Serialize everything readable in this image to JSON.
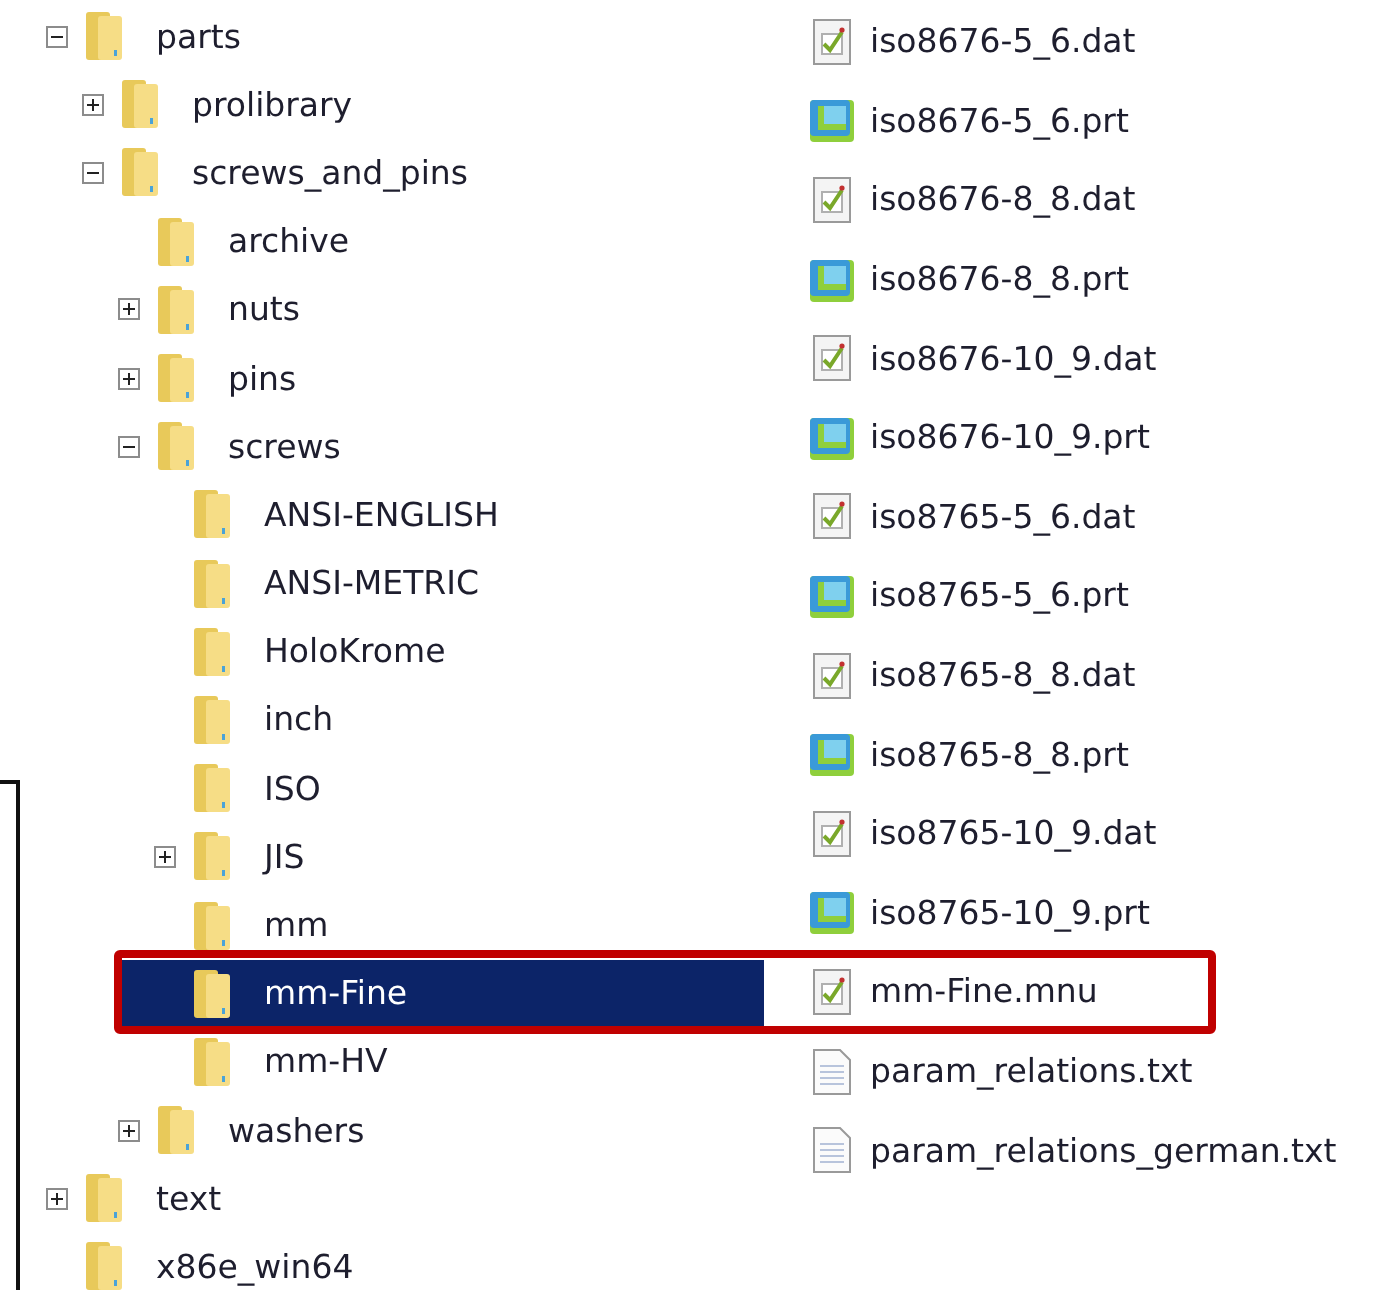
{
  "tree": [
    {
      "label": "parts",
      "expanded": true,
      "selected": false,
      "children": [
        {
          "label": "prolibrary",
          "expanded": false,
          "selected": false
        },
        {
          "label": "screws_and_pins",
          "expanded": true,
          "selected": false,
          "children": [
            {
              "label": "archive",
              "selected": false
            },
            {
              "label": "nuts",
              "expanded": false,
              "selected": false
            },
            {
              "label": "pins",
              "expanded": false,
              "selected": false
            },
            {
              "label": "screws",
              "expanded": true,
              "selected": false,
              "children": [
                {
                  "label": "ANSI-ENGLISH",
                  "selected": false
                },
                {
                  "label": "ANSI-METRIC",
                  "selected": false
                },
                {
                  "label": "HoloKrome",
                  "selected": false
                },
                {
                  "label": "inch",
                  "selected": false
                },
                {
                  "label": "ISO",
                  "selected": false
                },
                {
                  "label": "JIS",
                  "expanded": false,
                  "selected": false
                },
                {
                  "label": "mm",
                  "selected": false
                },
                {
                  "label": "mm-Fine",
                  "selected": true
                },
                {
                  "label": "mm-HV",
                  "selected": false
                }
              ]
            },
            {
              "label": "washers",
              "expanded": false,
              "selected": false
            }
          ]
        }
      ]
    },
    {
      "label": "text",
      "expanded": false,
      "selected": false
    },
    {
      "label": "x86e_win64",
      "selected": false
    }
  ],
  "files": [
    {
      "name": "iso8676-5_6.dat",
      "kind": "script"
    },
    {
      "name": "iso8676-5_6.prt",
      "kind": "part"
    },
    {
      "name": "iso8676-8_8.dat",
      "kind": "script"
    },
    {
      "name": "iso8676-8_8.prt",
      "kind": "part"
    },
    {
      "name": "iso8676-10_9.dat",
      "kind": "script"
    },
    {
      "name": "iso8676-10_9.prt",
      "kind": "part"
    },
    {
      "name": "iso8765-5_6.dat",
      "kind": "script"
    },
    {
      "name": "iso8765-5_6.prt",
      "kind": "part"
    },
    {
      "name": "iso8765-8_8.dat",
      "kind": "script"
    },
    {
      "name": "iso8765-8_8.prt",
      "kind": "part"
    },
    {
      "name": "iso8765-10_9.dat",
      "kind": "script"
    },
    {
      "name": "iso8765-10_9.prt",
      "kind": "part"
    },
    {
      "name": "mm-Fine.mnu",
      "kind": "script"
    },
    {
      "name": "param_relations.txt",
      "kind": "text"
    },
    {
      "name": "param_relations_german.txt",
      "kind": "text"
    }
  ],
  "annotation": {
    "kind": "frame"
  }
}
